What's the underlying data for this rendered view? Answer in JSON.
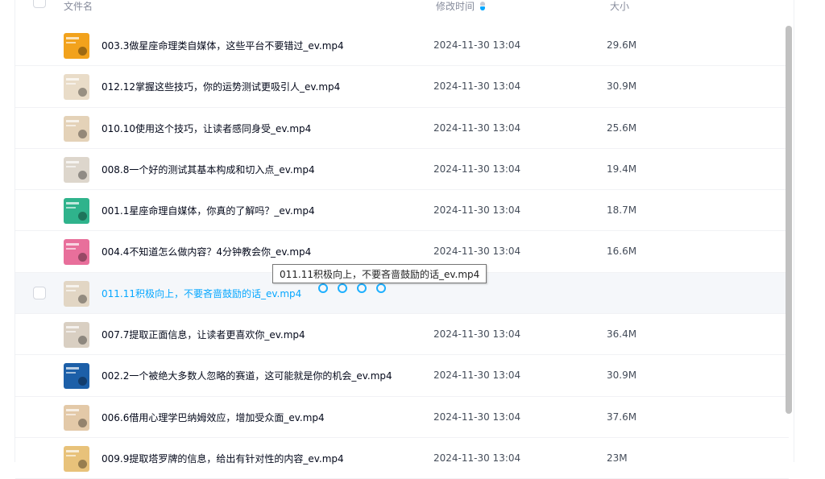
{
  "header": {
    "name_label": "文件名",
    "time_label": "修改时间",
    "size_label": "大小"
  },
  "files": [
    {
      "name": "003.3做星座命理类自媒体，这些平台不要错过_ev.mp4",
      "time": "2024-11-30 13:04",
      "size": "29.6M",
      "thumb_color": "#f2a21c"
    },
    {
      "name": "012.12掌握这些技巧，你的运势测试更吸引人_ev.mp4",
      "time": "2024-11-30 13:04",
      "size": "30.9M",
      "thumb_color": "#e9dcc8"
    },
    {
      "name": "010.10使用这个技巧，让读者感同身受_ev.mp4",
      "time": "2024-11-30 13:04",
      "size": "25.6M",
      "thumb_color": "#e4d2b8"
    },
    {
      "name": "008.8一个好的测试其基本构成和切入点_ev.mp4",
      "time": "2024-11-30 13:04",
      "size": "19.4M",
      "thumb_color": "#ddd6cc"
    },
    {
      "name": "001.1星座命理自媒体，你真的了解吗？_ev.mp4",
      "time": "2024-11-30 13:04",
      "size": "18.7M",
      "thumb_color": "#2fb38c"
    },
    {
      "name": "004.4不知道怎么做内容？4分钟教会你_ev.mp4",
      "time": "2024-11-30 13:04",
      "size": "16.6M",
      "thumb_color": "#e86f9b"
    },
    {
      "name": "011.11积极向上，不要吝啬鼓励的话_ev.mp4",
      "time": "",
      "size": "",
      "thumb_color": "#e2d6c4"
    },
    {
      "name": "007.7提取正面信息，让读者更喜欢你_ev.mp4",
      "time": "2024-11-30 13:04",
      "size": "36.4M",
      "thumb_color": "#d9cfc2"
    },
    {
      "name": "002.2一个被绝大多数人忽略的赛道，这可能就是你的机会_ev.mp4",
      "time": "2024-11-30 13:04",
      "size": "30.9M",
      "thumb_color": "#1c5fa8"
    },
    {
      "name": "006.6借用心理学巴纳姆效应，增加受众面_ev.mp4",
      "time": "2024-11-30 13:04",
      "size": "37.6M",
      "thumb_color": "#e3c9a8"
    },
    {
      "name": "009.9提取塔罗牌的信息，给出有针对性的内容_ev.mp4",
      "time": "2024-11-30 13:04",
      "size": "23M",
      "thumb_color": "#e8c27a"
    }
  ],
  "tooltip_text": "011.11积极向上，不要吝啬鼓励的话_ev.mp4",
  "colors": {
    "accent": "#06a7ff",
    "text": "#03081a",
    "muted": "#878c9c"
  }
}
